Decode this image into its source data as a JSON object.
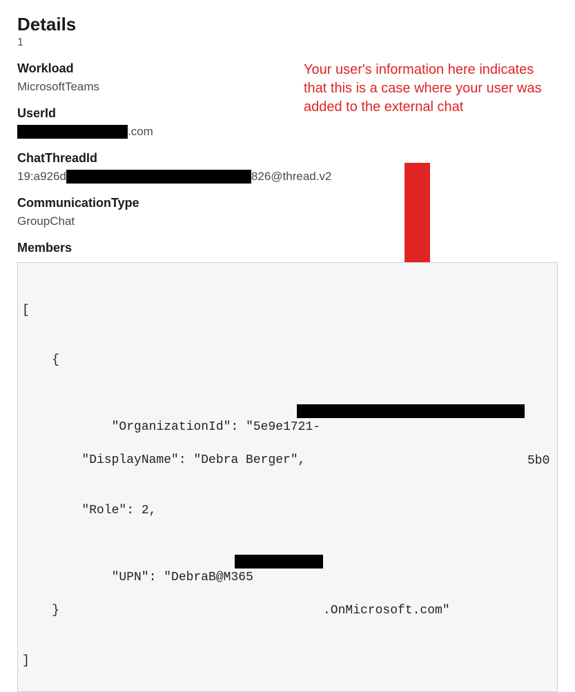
{
  "title": "Details",
  "count": "1",
  "fields": {
    "workload": {
      "label": "Workload",
      "value": "MicrosoftTeams"
    },
    "userId": {
      "label": "UserId",
      "suffix": ".com"
    },
    "chatThreadId": {
      "label": "ChatThreadId",
      "prefix": "19:a926d",
      "suffix": "826@thread.v2"
    },
    "commType": {
      "label": "CommunicationType",
      "value": "GroupChat"
    },
    "members": {
      "label": "Members"
    }
  },
  "annotation": "Your user's information here indicates that this is a case where your user was added to the external chat",
  "code": {
    "line1": "[",
    "line2": "    {",
    "line3_pre": "        \"OrganizationId\": \"5e9e1721-",
    "line3_suf": "5b0",
    "line4": "        \"DisplayName\": \"Debra Berger\",",
    "line5": "        \"Role\": 2,",
    "line6_pre": "        \"UPN\": \"DebraB@M365",
    "line6_suf": ".OnMicrosoft.com\"",
    "line7": "    }",
    "line8": "]"
  }
}
